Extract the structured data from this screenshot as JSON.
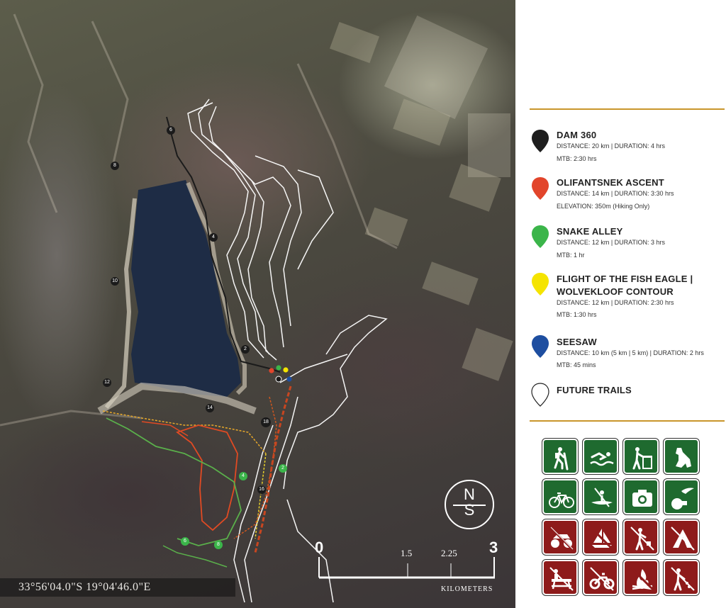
{
  "map": {
    "coordinates": "33°56'04.0\"S   19°04'46.0\"E",
    "compass": {
      "n": "N",
      "s": "S"
    },
    "scale": {
      "start": "0",
      "ticks": [
        "1.5",
        "2.25"
      ],
      "end": "3",
      "unit": "KILOMETERS"
    },
    "route_markers": [
      "6",
      "8",
      "4",
      "10",
      "2",
      "12",
      "14",
      "18",
      "16",
      "2",
      "4",
      "6",
      "8"
    ]
  },
  "legend": {
    "trails": [
      {
        "name": "DAM 360",
        "color": "#1e1e1e",
        "details": [
          "DISTANCE: 20 km  |  DURATION: 4 hrs",
          "MTB: 2:30 hrs"
        ]
      },
      {
        "name": "OLIFANTSNEK ASCENT",
        "color": "#e2452b",
        "details": [
          "DISTANCE: 14 km  |  DURATION: 3:30 hrs",
          "ELEVATION: 350m (Hiking Only)"
        ]
      },
      {
        "name": "SNAKE ALLEY",
        "color": "#3bb54a",
        "details": [
          "DISTANCE: 12 km  |  DURATION: 3 hrs",
          "MTB: 1 hr"
        ]
      },
      {
        "name": "FLIGHT OF THE FISH EAGLE |",
        "name2": "WOLVEKLOOF CONTOUR",
        "color": "#f5e400",
        "details": [
          "DISTANCE: 12 km  |  DURATION: 2:30 hrs",
          "MTB: 1:30 hrs"
        ]
      },
      {
        "name": "SEESAW",
        "color": "#1e4ea0",
        "details": [
          "DISTANCE: 10 km (5 km | 5 km)  |  DURATION: 2 hrs",
          "MTB: 45 mins"
        ]
      },
      {
        "name": "FUTURE TRAILS",
        "color": "#ffffff",
        "details": []
      }
    ],
    "activity_icons": {
      "allowed": [
        "hiking-icon",
        "swimming-icon",
        "litter-bin-icon",
        "dog-icon",
        "cycling-icon",
        "kayaking-icon",
        "camera-icon",
        "bird-watching-icon"
      ],
      "prohibited": [
        "no-quad-bikes-icon",
        "no-boating-icon",
        "no-littering-icon",
        "no-camping-icon",
        "no-picnics-icon",
        "no-motorbikes-icon",
        "no-fires-icon",
        "no-dumping-icon"
      ]
    }
  }
}
